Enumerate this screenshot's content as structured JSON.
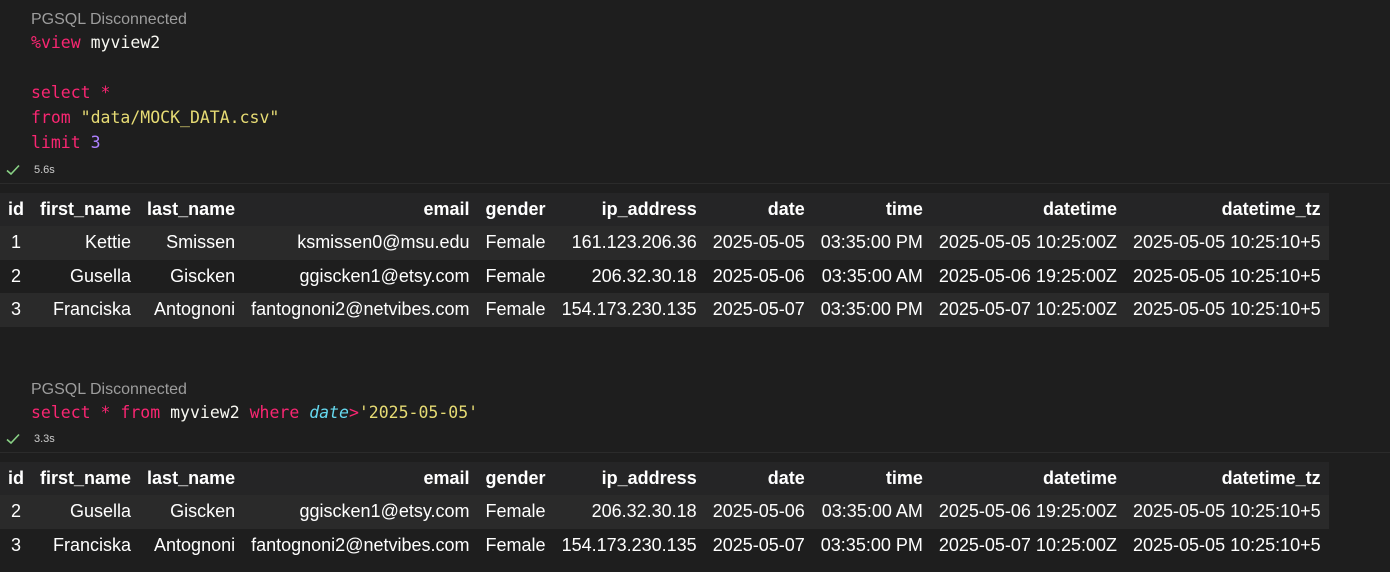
{
  "cells": [
    {
      "status": "PGSQL Disconnected",
      "code": {
        "line1_sym": "%",
        "line1_kw": "view",
        "line1_name": " myview2",
        "line2_kw": "select ",
        "line2_sym": "*",
        "line3_kw": "from ",
        "line3_str": "\"data/MOCK_DATA.csv\"",
        "line4_kw": "limit ",
        "line4_num": "3"
      },
      "exec_time": "5.6s",
      "table": {
        "headers": [
          "id",
          "first_name",
          "last_name",
          "email",
          "gender",
          "ip_address",
          "date",
          "time",
          "datetime",
          "datetime_tz"
        ],
        "rows": [
          [
            "1",
            "Kettie",
            "Smissen",
            "ksmissen0@msu.edu",
            "Female",
            "161.123.206.36",
            "2025-05-05",
            "03:35:00 PM",
            "2025-05-05 10:25:00Z",
            "2025-05-05 10:25:10+5"
          ],
          [
            "2",
            "Gusella",
            "Giscken",
            "ggiscken1@etsy.com",
            "Female",
            "206.32.30.18",
            "2025-05-06",
            "03:35:00 AM",
            "2025-05-06 19:25:00Z",
            "2025-05-05 10:25:10+5"
          ],
          [
            "3",
            "Franciska",
            "Antognoni",
            "fantognoni2@netvibes.com",
            "Female",
            "154.173.230.135",
            "2025-05-07",
            "03:35:00 PM",
            "2025-05-07 10:25:00Z",
            "2025-05-05 10:25:10+5"
          ]
        ]
      }
    },
    {
      "status": "PGSQL Disconnected",
      "code": {
        "kw1": "select ",
        "sym1": "*",
        "kw2": " from ",
        "name": "myview2 ",
        "kw3": "where ",
        "fn": "date",
        "sym2": ">",
        "str": "'2025-05-05'"
      },
      "exec_time": "3.3s",
      "table": {
        "headers": [
          "id",
          "first_name",
          "last_name",
          "email",
          "gender",
          "ip_address",
          "date",
          "time",
          "datetime",
          "datetime_tz"
        ],
        "rows": [
          [
            "2",
            "Gusella",
            "Giscken",
            "ggiscken1@etsy.com",
            "Female",
            "206.32.30.18",
            "2025-05-06",
            "03:35:00 AM",
            "2025-05-06 19:25:00Z",
            "2025-05-05 10:25:10+5"
          ],
          [
            "3",
            "Franciska",
            "Antognoni",
            "fantognoni2@netvibes.com",
            "Female",
            "154.173.230.135",
            "2025-05-07",
            "03:35:00 PM",
            "2025-05-07 10:25:00Z",
            "2025-05-05 10:25:10+5"
          ]
        ]
      }
    }
  ],
  "icons": {
    "exec_status": "check-icon"
  },
  "colors": {
    "keyword": "#f92672",
    "string": "#e6db74",
    "number": "#ae81ff",
    "builtin": "#66d9ef",
    "check": "#89d185"
  }
}
